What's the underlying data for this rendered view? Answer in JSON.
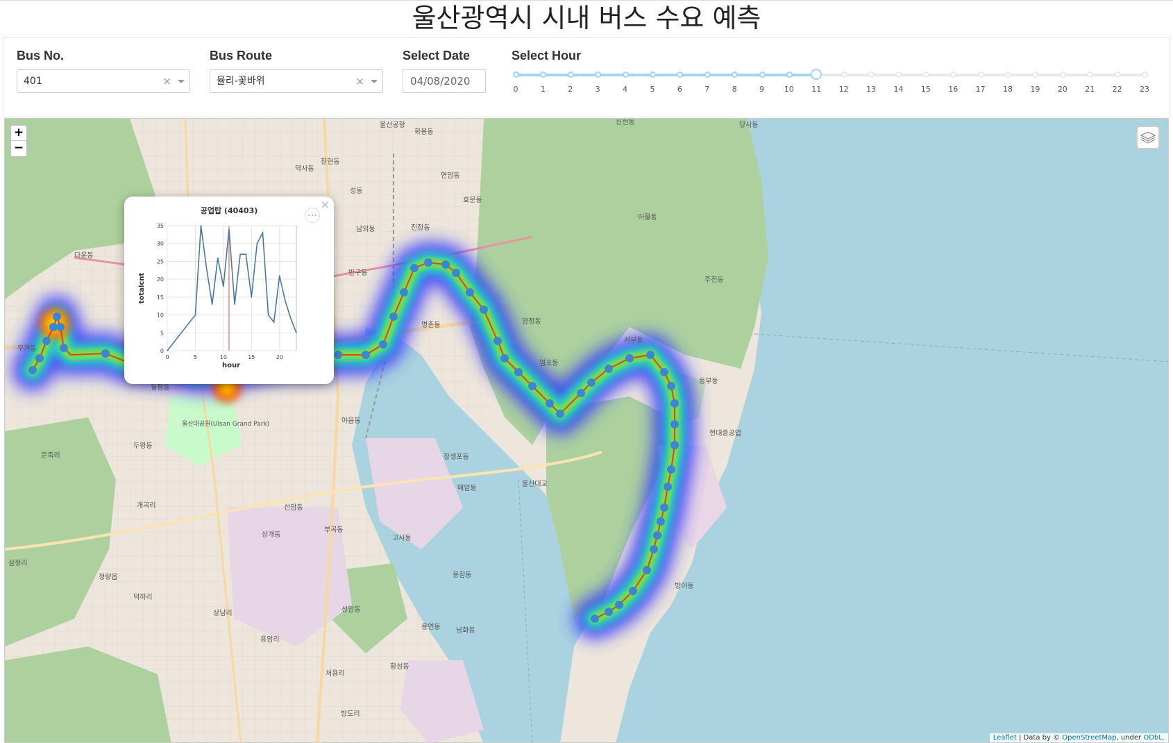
{
  "title": "울산광역시 시내 버스 수요 예측",
  "controls": {
    "bus_no": {
      "label": "Bus No.",
      "value": "401"
    },
    "bus_route": {
      "label": "Bus Route",
      "value": "율리-꽃바위"
    },
    "date": {
      "label": "Select Date",
      "value": "04/08/2020"
    },
    "hour": {
      "label": "Select Hour",
      "selected": 11,
      "marks": [
        "0",
        "1",
        "2",
        "3",
        "4",
        "5",
        "6",
        "7",
        "8",
        "9",
        "10",
        "11",
        "12",
        "13",
        "14",
        "15",
        "16",
        "17",
        "18",
        "19",
        "20",
        "21",
        "22",
        "23"
      ]
    }
  },
  "map": {
    "zoom_in": "+",
    "zoom_out": "−",
    "layers_icon": "layers-icon",
    "attribution": {
      "leaflet": "Leaflet",
      "data_by": "| Data by ©",
      "osm": "OpenStreetMap",
      "under": ", under",
      "odbl": "ODbL."
    },
    "places": [
      "울산공항",
      "화봉동",
      "장현동",
      "약사동",
      "연암동",
      "효문동",
      "성동",
      "다운동",
      "반구동",
      "남외동",
      "진장동",
      "명촌동",
      "양정동",
      "염포동",
      "어물동",
      "주전동",
      "서부동",
      "동부동",
      "당사동",
      "신현동",
      "현대중공업",
      "울산대공원(Ulsan Grand Park)",
      "두왕동",
      "야음동",
      "장생포동",
      "매암동",
      "선암동",
      "상개동",
      "부곡동",
      "고사동",
      "용잠동",
      "성암동",
      "용연동",
      "남화동",
      "황성동",
      "처용리",
      "방도리",
      "상남리",
      "용암리",
      "개곡리",
      "청량읍",
      "덕하리",
      "삼정리",
      "문죽리",
      "무거동",
      "월평동",
      "방어동",
      "울산대교"
    ],
    "route_color": "#d8413a",
    "stop_color": "#3a87cf",
    "popup": {
      "close": "×",
      "menu": "…",
      "chart_data": {
        "type": "line",
        "title": "공업탑 (40403)",
        "xlabel": "hour",
        "ylabel": "totalcnt",
        "xlim": [
          0,
          23
        ],
        "ylim": [
          0,
          35
        ],
        "xticks": [
          "0",
          "5",
          "10",
          "15",
          "20"
        ],
        "yticks": [
          "0",
          "5",
          "10",
          "15",
          "20",
          "25",
          "30",
          "35"
        ],
        "x": [
          0,
          5,
          6,
          7,
          8,
          9,
          10,
          11,
          12,
          13,
          14,
          15,
          16,
          17,
          18,
          19,
          20,
          21,
          22,
          23
        ],
        "series": [
          {
            "values": [
              0,
              10,
              35,
              23,
              13,
              26,
              18,
              34,
              13,
              27,
              27,
              15,
              30,
              33,
              10,
              8,
              21,
              14,
              9,
              5
            ]
          }
        ],
        "marker_hour": 11,
        "line_color": "#4a78a8",
        "marker_color": "#e05050"
      }
    }
  }
}
